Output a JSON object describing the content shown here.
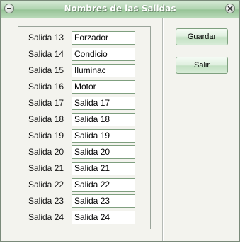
{
  "window": {
    "title": "Nombres de las Salidas"
  },
  "outputs": [
    {
      "label": "Salida 13",
      "value": "Forzador"
    },
    {
      "label": "Salida 14",
      "value": "Condicio"
    },
    {
      "label": "Salida 15",
      "value": "Iluminac"
    },
    {
      "label": "Salida 16",
      "value": "Motor"
    },
    {
      "label": "Salida 17",
      "value": "Salida 17"
    },
    {
      "label": "Salida 18",
      "value": "Salida 18"
    },
    {
      "label": "Salida 19",
      "value": "Salida 19"
    },
    {
      "label": "Salida 20",
      "value": "Salida 20"
    },
    {
      "label": "Salida 21",
      "value": "Salida 21"
    },
    {
      "label": "Salida 22",
      "value": "Salida 22"
    },
    {
      "label": "Salida 23",
      "value": "Salida 23"
    },
    {
      "label": "Salida 24",
      "value": "Salida 24"
    }
  ],
  "buttons": {
    "save_label": "Guardar",
    "exit_label": "Salir"
  }
}
